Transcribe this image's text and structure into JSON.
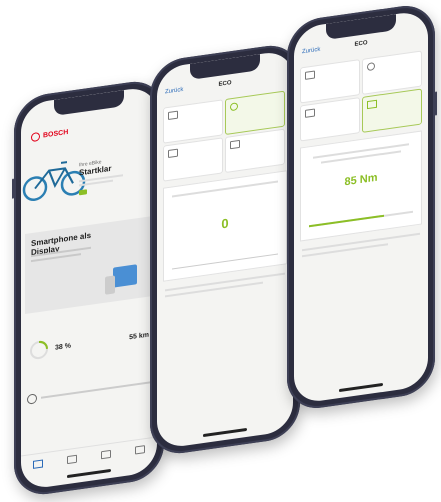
{
  "colors": {
    "phone_frame": "#2c2d3f",
    "screen_bg": "#f4f4f2",
    "brand_red": "#e2001a",
    "accent_green": "#8cbf26",
    "link_blue": "#2a6ab8"
  },
  "phone1": {
    "brand": "BOSCH",
    "bike_status_small": "Ihre eBike",
    "bike_status": "Startklar",
    "hero_title": "Smartphone als Display",
    "battery_percent": "38 %",
    "range": "55 km"
  },
  "phone2": {
    "back_label": "Zurück",
    "title": "ECO",
    "value": "0"
  },
  "phone3": {
    "back_label": "Zurück",
    "title": "ECO",
    "torque_value": "85 Nm"
  }
}
